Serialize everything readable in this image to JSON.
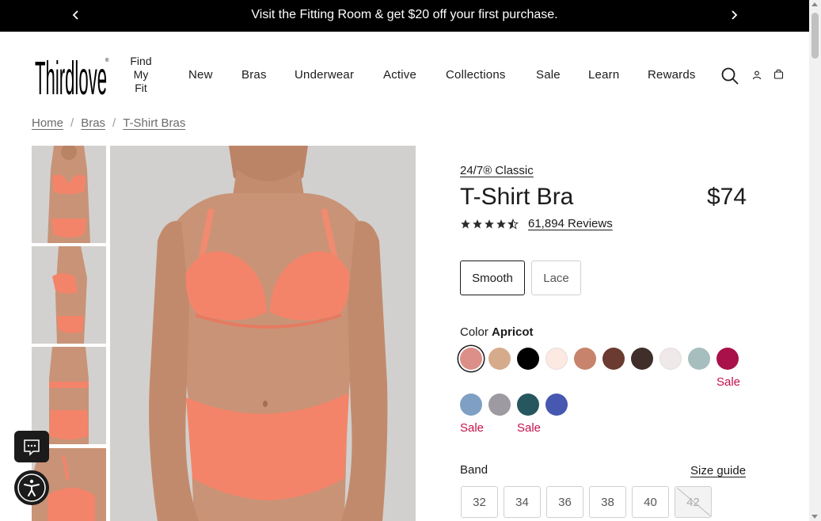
{
  "announcement": {
    "text": "Visit the Fitting Room & get $20 off your first purchase."
  },
  "header": {
    "logo_text": "Thirdlove",
    "find_my_fit": [
      "Find",
      "My",
      "Fit"
    ],
    "nav": [
      "New",
      "Bras",
      "Underwear",
      "Active",
      "Collections",
      "Sale",
      "Learn",
      "Rewards"
    ],
    "icons": [
      "search-icon",
      "account-icon",
      "cart-icon"
    ]
  },
  "breadcrumb": [
    "Home",
    "Bras",
    "T-Shirt Bras"
  ],
  "product": {
    "collection": "24/7® Classic",
    "title": "T-Shirt Bra",
    "price": "$74",
    "rating": 4.5,
    "reviews": "61,894 Reviews",
    "styles": [
      {
        "label": "Smooth",
        "selected": true
      },
      {
        "label": "Lace",
        "selected": false
      }
    ],
    "color_label": "Color",
    "color_selected": "Apricot",
    "swatches": [
      {
        "color": "#dc8f88",
        "selected": true,
        "sale": false
      },
      {
        "color": "#d6ab8c",
        "selected": false,
        "sale": false
      },
      {
        "color": "#000000",
        "selected": false,
        "sale": false
      },
      {
        "color": "#fce9e2",
        "selected": false,
        "sale": false
      },
      {
        "color": "#c7836b",
        "selected": false,
        "sale": false
      },
      {
        "color": "#6b3a30",
        "selected": false,
        "sale": false
      },
      {
        "color": "#3f2e2a",
        "selected": false,
        "sale": false
      },
      {
        "color": "#efe9ea",
        "selected": false,
        "sale": false
      },
      {
        "color": "#a6bfbe",
        "selected": false,
        "sale": false
      },
      {
        "color": "#a8114a",
        "selected": false,
        "sale": true
      },
      {
        "color": "#7fa0c4",
        "selected": false,
        "sale": true
      },
      {
        "color": "#9d9aa1",
        "selected": false,
        "sale": false
      },
      {
        "color": "#26575e",
        "selected": false,
        "sale": true
      },
      {
        "color": "#4658b0",
        "selected": false,
        "sale": false
      }
    ],
    "sale_label": "Sale",
    "band_label": "Band",
    "size_guide": "Size guide",
    "bands": [
      {
        "label": "32",
        "available": true
      },
      {
        "label": "34",
        "available": true
      },
      {
        "label": "36",
        "available": true
      },
      {
        "label": "38",
        "available": true
      },
      {
        "label": "40",
        "available": true
      },
      {
        "label": "42",
        "available": false
      }
    ]
  },
  "colors": {
    "sale": "#c4124b",
    "skin": "#c99377",
    "bra": "#f48469"
  }
}
